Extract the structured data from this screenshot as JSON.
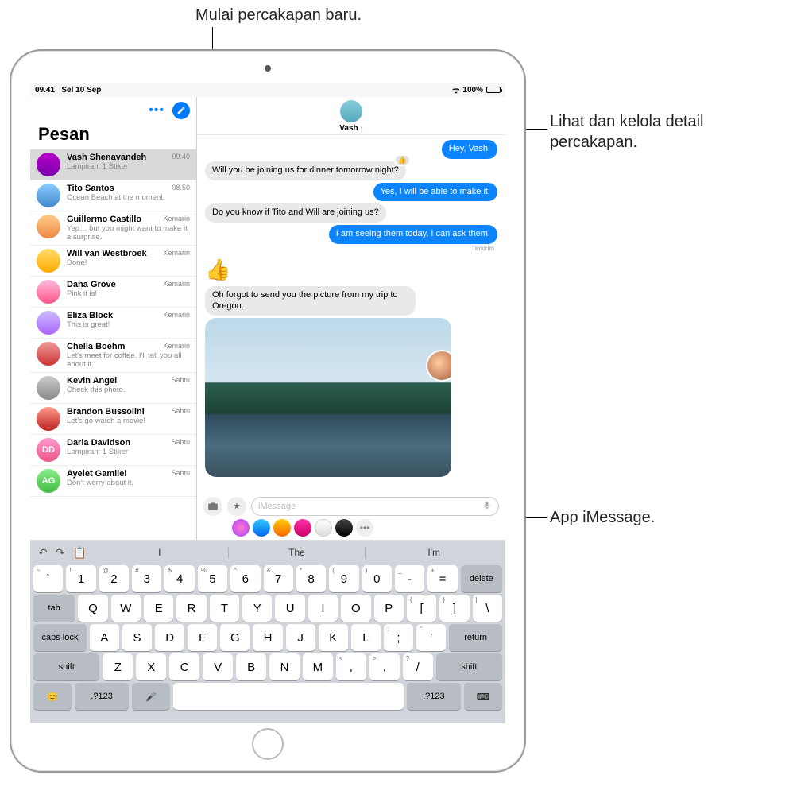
{
  "callouts": {
    "compose": "Mulai percakapan baru.",
    "details": "Lihat dan kelola detail percakapan.",
    "appstrip": "App iMessage."
  },
  "statusbar": {
    "time": "09.41",
    "date": "Sel 10 Sep",
    "battery_pct": "100%"
  },
  "sidebar": {
    "title": "Pesan",
    "items": [
      {
        "name": "Vash Shenavandeh",
        "time": "09.40",
        "preview": "Lampiran: 1 Stiker"
      },
      {
        "name": "Tito Santos",
        "time": "08.50",
        "preview": "Ocean Beach at the moment."
      },
      {
        "name": "Guillermo Castillo",
        "time": "Kemarin",
        "preview": "Yep… but you might want to make it a surprise."
      },
      {
        "name": "Will van Westbroek",
        "time": "Kemarin",
        "preview": "Done!"
      },
      {
        "name": "Dana Grove",
        "time": "Kemarin",
        "preview": "Pink it is!"
      },
      {
        "name": "Eliza Block",
        "time": "Kemarin",
        "preview": "This is great!"
      },
      {
        "name": "Chella Boehm",
        "time": "Kemarin",
        "preview": "Let's meet for coffee. I'll tell you all about it."
      },
      {
        "name": "Kevin Angel",
        "time": "Sabtu",
        "preview": "Check this photo."
      },
      {
        "name": "Brandon Bussolini",
        "time": "Sabtu",
        "preview": "Let's go watch a movie!"
      },
      {
        "name": "Darla Davidson",
        "time": "Sabtu",
        "preview": "Lampiran: 1 Stiker",
        "initials": "DD"
      },
      {
        "name": "Ayelet Gamliel",
        "time": "Sabtu",
        "preview": "Don't worry about it.",
        "initials": "AG"
      }
    ]
  },
  "conversation": {
    "contact_name": "Vash",
    "messages": [
      {
        "dir": "out",
        "text": "Hey, Vash!"
      },
      {
        "dir": "in",
        "text": "Will you be joining us for dinner tomorrow night?",
        "reaction": "👍"
      },
      {
        "dir": "out",
        "text": "Yes, I will be able to make it."
      },
      {
        "dir": "in",
        "text": "Do you know if Tito and Will are joining us?"
      },
      {
        "dir": "out",
        "text": "I am seeing them today, I can ask them.",
        "status": "Terkirim"
      },
      {
        "dir": "in",
        "emoji": "👍"
      },
      {
        "dir": "in",
        "text": "Oh forgot to send you the picture from my trip to Oregon."
      },
      {
        "dir": "in",
        "photo": true
      }
    ],
    "input_placeholder": "iMessage"
  },
  "keyboard": {
    "suggestions": [
      "I",
      "The",
      "I'm"
    ],
    "rows": {
      "num": [
        [
          "~",
          "`"
        ],
        [
          "!",
          "1"
        ],
        [
          "@",
          "2"
        ],
        [
          "#",
          "3"
        ],
        [
          "$",
          "4"
        ],
        [
          "%",
          "5"
        ],
        [
          "^",
          "6"
        ],
        [
          "&",
          "7"
        ],
        [
          "*",
          "8"
        ],
        [
          "(",
          "9"
        ],
        [
          ")",
          "0"
        ],
        [
          "_",
          "-"
        ],
        [
          "+",
          "="
        ]
      ],
      "qwerty": [
        "Q",
        "W",
        "E",
        "R",
        "T",
        "Y",
        "U",
        "I",
        "O",
        "P",
        [
          "{",
          "["
        ],
        [
          "}",
          "]"
        ]
      ],
      "asdf": [
        "A",
        "S",
        "D",
        "F",
        "G",
        "H",
        "J",
        "K",
        "L",
        [
          ":",
          ";"
        ],
        [
          "\"",
          "'"
        ]
      ],
      "zxcv": [
        "Z",
        "X",
        "C",
        "V",
        "B",
        "N",
        "M",
        [
          "<",
          ","
        ],
        [
          ">",
          "."
        ],
        [
          "?",
          "/"
        ]
      ]
    },
    "mods": {
      "delete": "delete",
      "tab": "tab",
      "caps": "caps lock",
      "return": "return",
      "shift": "shift",
      "num": ".?123",
      "pipe": [
        "|",
        "\\"
      ]
    }
  }
}
